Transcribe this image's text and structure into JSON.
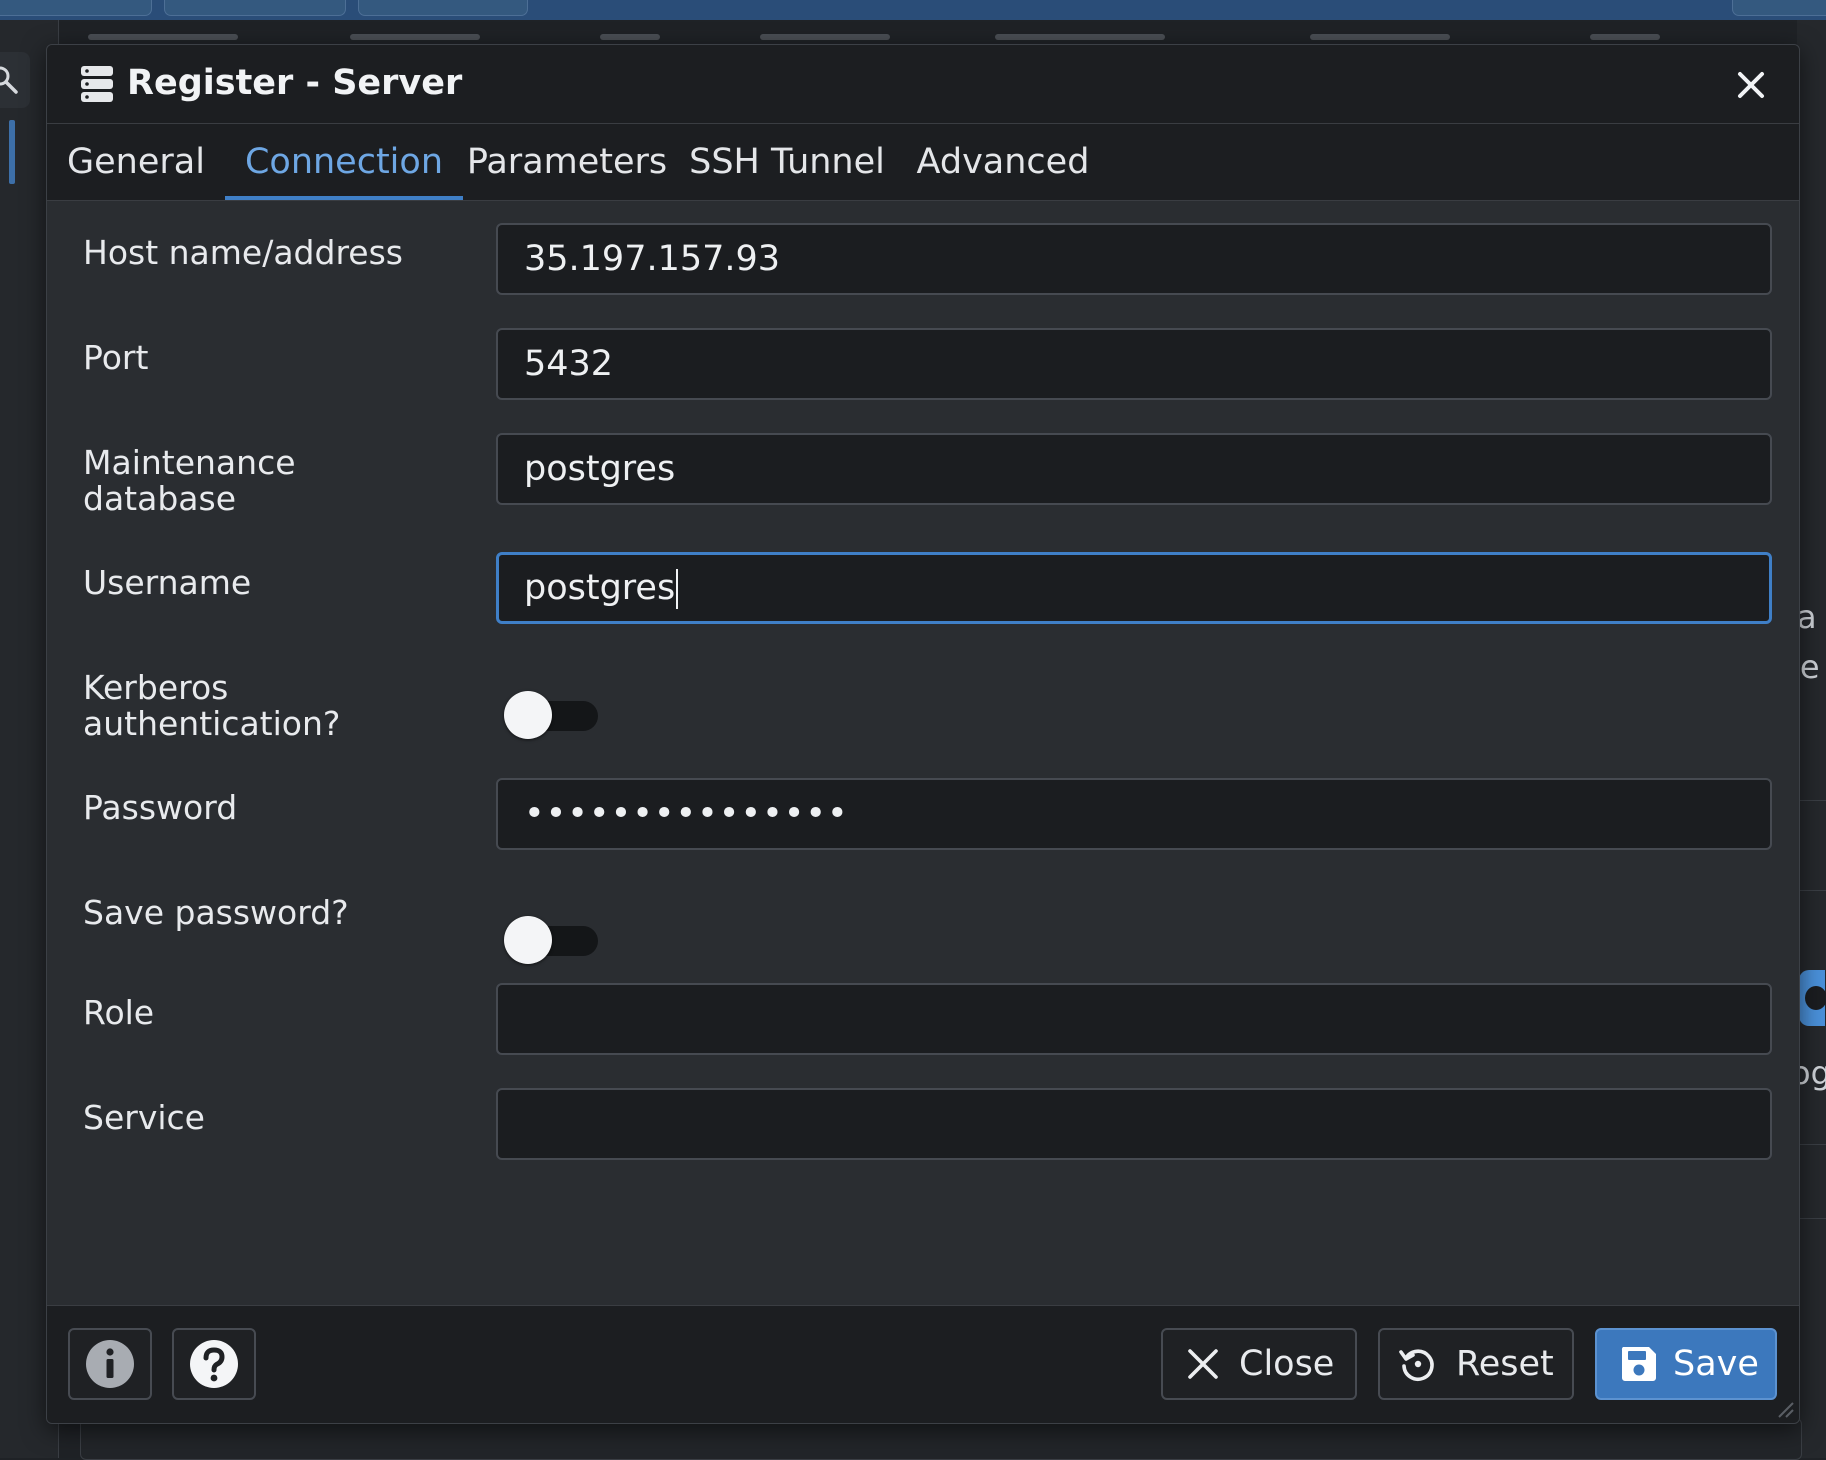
{
  "dialog": {
    "title": "Register - Server",
    "tabs": [
      {
        "label": "General",
        "active": false
      },
      {
        "label": "Connection",
        "active": true
      },
      {
        "label": "Parameters",
        "active": false
      },
      {
        "label": "SSH Tunnel",
        "active": false
      },
      {
        "label": "Advanced",
        "active": false
      }
    ]
  },
  "form": {
    "host": {
      "label": "Host name/address",
      "value": "35.197.157.93"
    },
    "port": {
      "label": "Port",
      "value": "5432"
    },
    "maintenance_db": {
      "label_line1": "Maintenance",
      "label_line2": "database",
      "value": "postgres"
    },
    "username": {
      "label": "Username",
      "value": "postgres"
    },
    "kerberos": {
      "label_line1": "Kerberos",
      "label_line2": "authentication?",
      "enabled": false
    },
    "password": {
      "label": "Password",
      "value": "•••••••••••••••"
    },
    "save_password": {
      "label": "Save password?",
      "enabled": false
    },
    "role": {
      "label": "Role",
      "value": ""
    },
    "service": {
      "label": "Service",
      "value": ""
    }
  },
  "footer": {
    "close_label": "Close",
    "reset_label": "Reset",
    "save_label": "Save"
  },
  "background": {
    "right_fragments": [
      "a",
      "ie",
      "og"
    ]
  },
  "colors": {
    "accent": "#3f7fc7",
    "active_tab_text": "#6ea7e4",
    "save_button": "#3c78bd",
    "dialog_bg": "#2a2d31",
    "input_bg": "#1b1d20"
  },
  "icons": {
    "title": "server-icon",
    "close": "close-icon",
    "info": "info-icon",
    "help": "help-icon",
    "close_button": "x-icon",
    "reset_button": "reset-icon",
    "save_button": "floppy-disk-icon"
  }
}
